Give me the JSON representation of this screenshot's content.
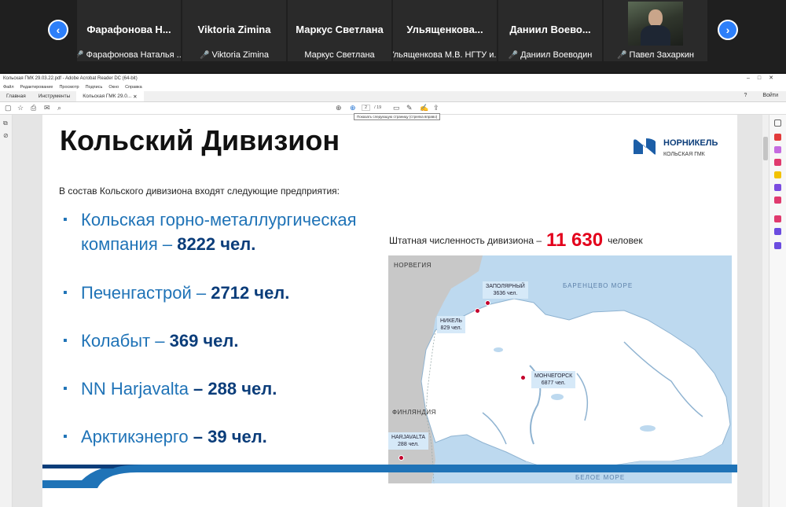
{
  "participants": [
    {
      "display_name": "Фарафонова Н...",
      "caption": "Фарафонова Наталья ...",
      "muted": true
    },
    {
      "display_name": "Viktoria Zimina",
      "caption": "Viktoria Zimina",
      "muted": true
    },
    {
      "display_name": "Маркус Светлана",
      "caption": "Маркус Светлана",
      "muted": false
    },
    {
      "display_name": "Ульященкова...",
      "caption": "Ульященкова М.В. НГТУ и...",
      "muted": false
    },
    {
      "display_name": "Даниил Воево...",
      "caption": "Даниил Воеводин",
      "muted": true
    },
    {
      "display_name": "",
      "caption": "Павел Захаркин",
      "muted": true,
      "has_video": true
    }
  ],
  "mic_muted_icon": "🎤",
  "acrobat": {
    "title": "Кольская ГМК 29.03.22.pdf - Adobe Acrobat Reader DC (64-bit)",
    "menu": [
      "Файл",
      "Редактирование",
      "Просмотр",
      "Подпись",
      "Окно",
      "Справка"
    ],
    "tabs": [
      "Главная",
      "Инструменты",
      "Кольская ГМК 29.0..."
    ],
    "login": "Войти",
    "help": "?",
    "page_current": "2",
    "page_total": "/ 19",
    "tooltip": "Показать следующую страницу (стрелка вправо)"
  },
  "slide": {
    "title": "Кольский Дивизион",
    "logo_name": "НОРНИКЕЛЬ",
    "logo_sub": "КОЛЬСКАЯ ГМК",
    "intro": "В состав Кольского дивизиона входят следующие предприятия:",
    "bullets": [
      {
        "line1": "Кольская горно-металлургическая",
        "line2": "компания – ",
        "num": "8222 чел."
      },
      {
        "name": "Печенгастрой – ",
        "num": "2712 чел."
      },
      {
        "name": "Колабыт – ",
        "num": "369 чел."
      },
      {
        "name": "NN Harjavalta ",
        "num": "– 288 чел."
      },
      {
        "name": "Арктикэнерго ",
        "num": "– 39 чел."
      }
    ],
    "headcount_label": "Штатная численность дивизиона –",
    "headcount_value": "11 630",
    "headcount_unit": "человек",
    "map": {
      "seas": [
        "БАРЕНЦЕВО МОРЕ",
        "БЕЛОЕ МОРЕ"
      ],
      "countries": [
        "НОРВЕГИЯ",
        "ФИНЛЯНДИЯ"
      ],
      "cities": [
        {
          "name": "ЗАПОЛЯРНЫЙ",
          "count": "3636 чел."
        },
        {
          "name": "НИКЕЛЬ",
          "count": "829 чел."
        },
        {
          "name": "МОНЧЕГОРСК",
          "count": "6877 чел."
        },
        {
          "name": "HARJAVALTA",
          "count": "288 чел."
        }
      ]
    }
  },
  "colors": {
    "accent_blue": "#1f73b7",
    "dark_blue": "#0b3d7a",
    "red": "#e3001b",
    "zoom_blue": "#2d7ff9"
  }
}
